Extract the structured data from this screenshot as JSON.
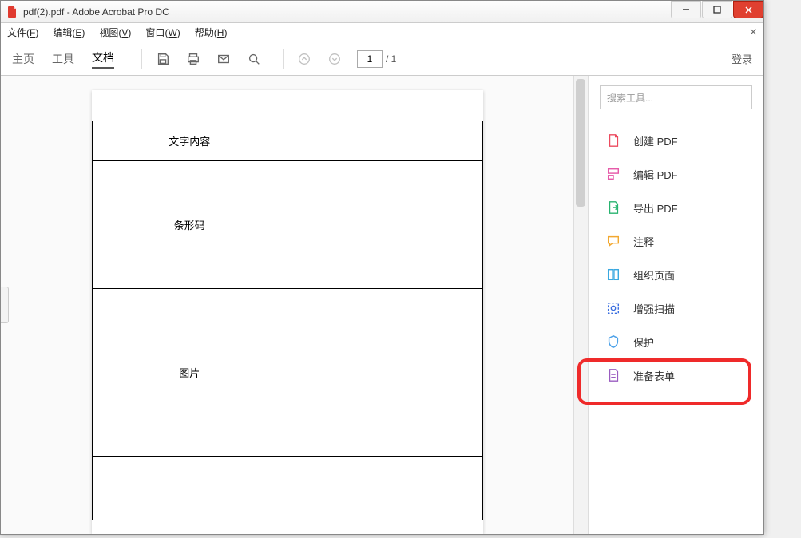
{
  "window": {
    "title": "pdf(2).pdf - Adobe Acrobat Pro DC"
  },
  "menubar": {
    "items": [
      {
        "label": "文件",
        "accel": "F"
      },
      {
        "label": "编辑",
        "accel": "E"
      },
      {
        "label": "视图",
        "accel": "V"
      },
      {
        "label": "窗口",
        "accel": "W"
      },
      {
        "label": "帮助",
        "accel": "H"
      }
    ]
  },
  "toolbar": {
    "tabs": {
      "home": "主页",
      "tools": "工具",
      "doc": "文档"
    },
    "page_current": "1",
    "page_total": "/ 1",
    "login": "登录"
  },
  "document": {
    "rows": [
      {
        "label": "文字内容"
      },
      {
        "label": "条形码"
      },
      {
        "label": "图片"
      },
      {
        "label": ""
      }
    ]
  },
  "rightPanel": {
    "search_placeholder": "搜索工具...",
    "tools": [
      {
        "key": "create",
        "label": "创建 PDF",
        "color": "#ec4a5e"
      },
      {
        "key": "edit",
        "label": "编辑 PDF",
        "color": "#e65aa9"
      },
      {
        "key": "export",
        "label": "导出 PDF",
        "color": "#27b36f"
      },
      {
        "key": "comment",
        "label": "注释",
        "color": "#f2a830"
      },
      {
        "key": "organize",
        "label": "组织页面",
        "color": "#3aa8e0"
      },
      {
        "key": "enhance",
        "label": "增强扫描",
        "color": "#3a6ee0"
      },
      {
        "key": "protect",
        "label": "保护",
        "color": "#4aa0e8"
      },
      {
        "key": "form",
        "label": "准备表单",
        "color": "#9a5cc0"
      }
    ]
  }
}
